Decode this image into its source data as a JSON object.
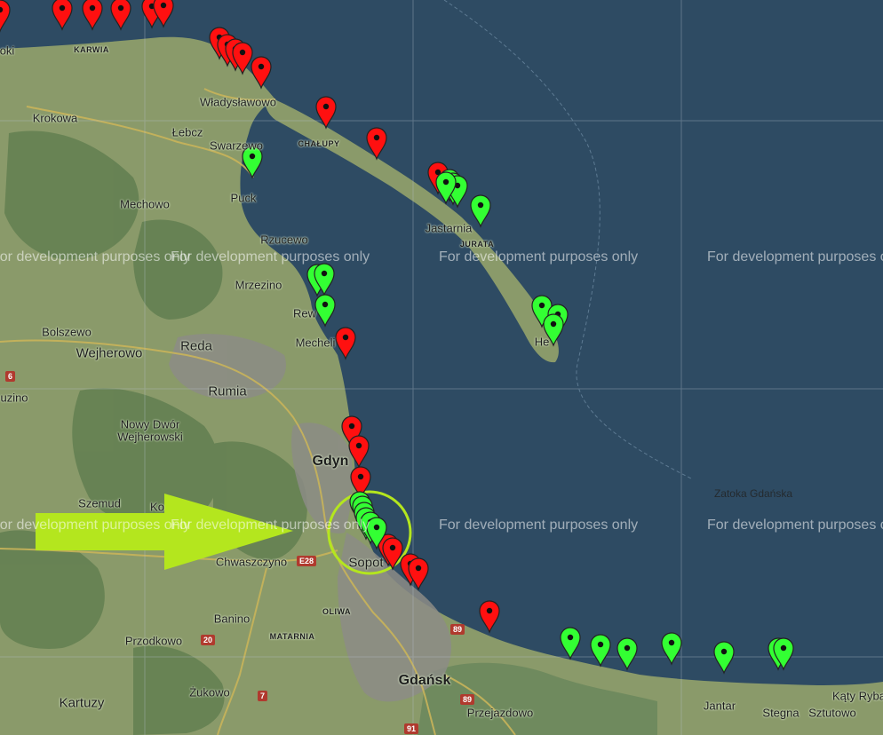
{
  "watermark": "For development purposes only",
  "colors": {
    "sea": "#2e4b63",
    "land": "#8a9a6a",
    "marker_red": "#ff1010",
    "marker_green": "#33ff33",
    "highlight": "#b4e61e"
  },
  "labels": {
    "karwia": "KARWIA",
    "oki": "oki",
    "krokowa": "Krokowa",
    "wladyslawowo": "Władysławowo",
    "lebcz": "Łebcz",
    "swarzewo": "Swarzewo",
    "chalupy": "CHAŁUPY",
    "mechowo": "Mechowo",
    "puck": "Puck",
    "jastarnia": "Jastarnia",
    "jurata": "JURATA",
    "rzucewo": "Rzucewo",
    "mrzezino": "Mrzezino",
    "rew": "Rew",
    "mechelinki": "Mecheli",
    "hel": "He",
    "bolszewo": "Bolszewo",
    "wejherowo": "Wejherowo",
    "reda": "Reda",
    "rumia": "Rumia",
    "luzino": "uzino",
    "nowy_dwor": "Nowy Dwór",
    "wejherowski": "Wejherowski",
    "gdynia": "Gdyn",
    "szemud": "Szemud",
    "ko": "Ko",
    "chwaszczyno": "Chwaszczyno",
    "sopot": "Sopot",
    "oliwa": "OLIWA",
    "banino": "Banino",
    "matarnia": "MATARNIA",
    "przodkowo": "Przodkowo",
    "zukowo": "Żukowo",
    "kartuzy": "Kartuzy",
    "gdansk": "Gdańsk",
    "przejazdowo": "Przejazdowo",
    "jantar": "Jantar",
    "stegna": "Stegna",
    "sztutowo": "Sztutowo",
    "katy_rybackie": "Kąty Ryba",
    "zatoka": "Zatoka Gdańska"
  },
  "road_shields": [
    "E28",
    "20",
    "7",
    "89",
    "89",
    "91",
    "6"
  ],
  "markers": {
    "red_count": 27,
    "green_count": 23
  }
}
